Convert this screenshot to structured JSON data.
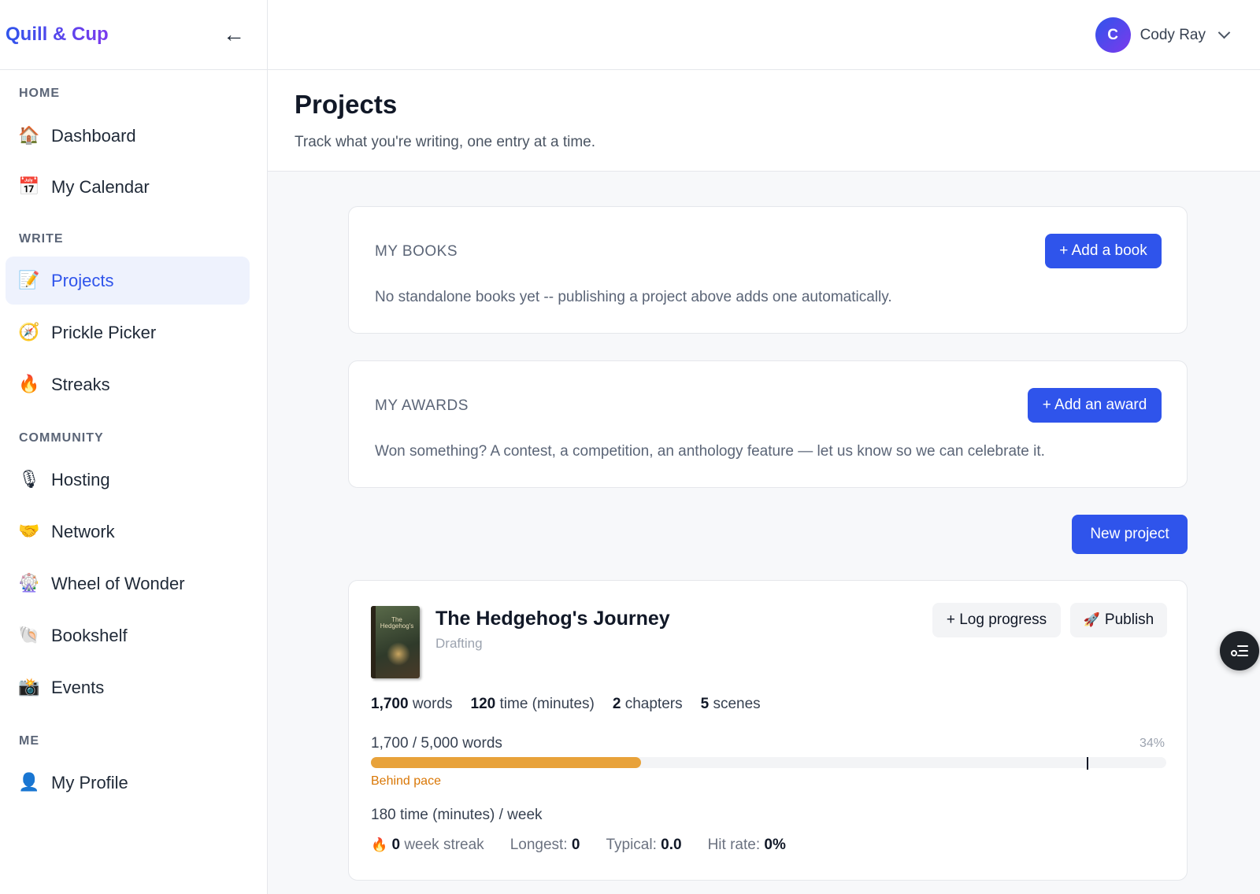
{
  "app": {
    "logo": "Quill & Cup",
    "collapse_icon": "←"
  },
  "user": {
    "initial": "C",
    "name": "Cody Ray"
  },
  "sidebar": {
    "sections": [
      {
        "label": "HOME",
        "items": [
          {
            "label": "Dashboard",
            "icon": "🏠",
            "icon_name": "house-icon"
          },
          {
            "label": "My Calendar",
            "icon": "📅",
            "icon_name": "calendar-icon"
          }
        ]
      },
      {
        "label": "WRITE",
        "items": [
          {
            "label": "Projects",
            "icon": "📝",
            "icon_name": "memo-icon",
            "active": true
          },
          {
            "label": "Prickle Picker",
            "icon": "🧭",
            "icon_name": "compass-icon"
          },
          {
            "label": "Streaks",
            "icon": "🔥",
            "icon_name": "fire-icon"
          }
        ]
      },
      {
        "label": "COMMUNITY",
        "items": [
          {
            "label": "Hosting",
            "icon": "🎙",
            "icon_name": "microphone-icon"
          },
          {
            "label": "Network",
            "icon": "🤝",
            "icon_name": "handshake-icon"
          },
          {
            "label": "Wheel of Wonder",
            "icon": "🎡",
            "icon_name": "ferris-wheel-icon"
          },
          {
            "label": "Bookshelf",
            "icon": "🐚",
            "icon_name": "shell-icon"
          },
          {
            "label": "Events",
            "icon": "📸",
            "icon_name": "camera-icon"
          }
        ]
      },
      {
        "label": "ME",
        "items": [
          {
            "label": "My Profile",
            "icon": "👤",
            "icon_name": "person-icon"
          }
        ]
      }
    ]
  },
  "page": {
    "title": "Projects",
    "subtitle": "Track what you're writing, one entry at a time."
  },
  "books_card": {
    "label": "MY BOOKS",
    "button": "+ Add a book",
    "text": "No standalone books yet -- publishing a project above adds one automatically."
  },
  "awards_card": {
    "label": "MY AWARDS",
    "button": "+ Add an award",
    "text": "Won something? A contest, a competition, an anthology feature — let us know so we can celebrate it."
  },
  "new_project_button": "New project",
  "project": {
    "title": "The Hedgehog's Journey",
    "cover_title": "The Hedgehog's",
    "status": "Drafting",
    "log_button": "+ Log progress",
    "publish_icon": "🚀",
    "publish_label": "Publish",
    "stats": [
      {
        "value": "1,700",
        "unit": "words"
      },
      {
        "value": "120",
        "unit": "time (minutes)"
      },
      {
        "value": "2",
        "unit": "chapters"
      },
      {
        "value": "5",
        "unit": "scenes"
      }
    ],
    "goal_text": "1,700 / 5,000 words",
    "goal_percent": "34%",
    "progress_fraction": 0.34,
    "pace_fraction": 0.9,
    "pace_status": "Behind pace",
    "weekly_goal": "180 time (minutes) / week",
    "streak": {
      "fire": "🔥",
      "current_value": "0",
      "current_label": "week streak",
      "longest_label": "Longest:",
      "longest_value": "0",
      "typical_label": "Typical:",
      "typical_value": "0.0",
      "hit_label": "Hit rate:",
      "hit_value": "0%"
    }
  },
  "colors": {
    "accent": "#2f54eb",
    "progress": "#e8a23a",
    "behind": "#d97706"
  }
}
